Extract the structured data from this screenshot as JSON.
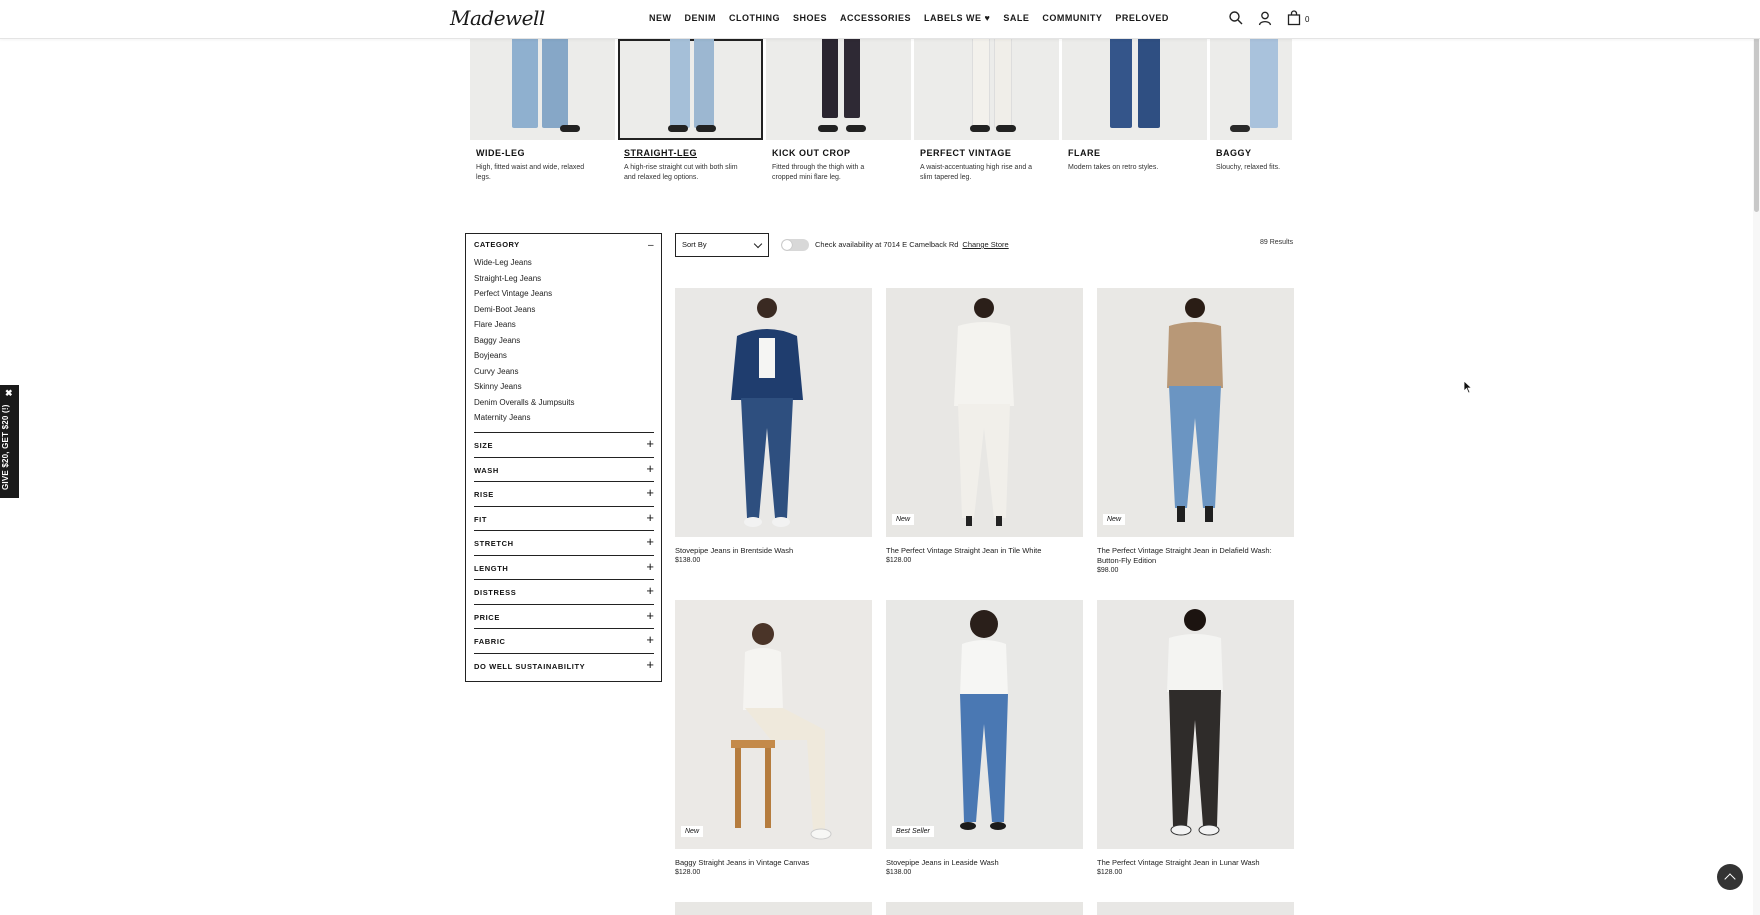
{
  "header": {
    "logo": "Madewell",
    "nav": [
      "NEW",
      "DENIM",
      "CLOTHING",
      "SHOES",
      "ACCESSORIES",
      "LABELS WE ♥",
      "SALE",
      "COMMUNITY",
      "PRELOVED"
    ],
    "bag_count": "0",
    "icons": [
      "search-icon",
      "account-icon",
      "bag-icon"
    ]
  },
  "fits": [
    {
      "title": "WIDE-LEG",
      "desc": "High, fitted waist and wide, relaxed legs.",
      "selected": false
    },
    {
      "title": "STRAIGHT-LEG",
      "desc": "A high-rise straight cut with both slim and relaxed leg options.",
      "selected": true
    },
    {
      "title": "KICK OUT CROP",
      "desc": "Fitted through the thigh with a cropped mini flare leg.",
      "selected": false
    },
    {
      "title": "PERFECT VINTAGE",
      "desc": "A waist-accentuating high rise and a slim tapered leg.",
      "selected": false
    },
    {
      "title": "FLARE",
      "desc": "Modern takes on retro styles.",
      "selected": false
    },
    {
      "title": "BAGGY",
      "desc": "Slouchy, relaxed fits.",
      "selected": false
    }
  ],
  "sidebar": {
    "category_title": "CATEGORY",
    "category_toggle": "–",
    "categories": [
      "Wide-Leg Jeans",
      "Straight-Leg Jeans",
      "Perfect Vintage Jeans",
      "Demi-Boot Jeans",
      "Flare Jeans",
      "Baggy Jeans",
      "Boyjeans",
      "Curvy Jeans",
      "Skinny Jeans",
      "Denim Overalls & Jumpsuits",
      "Maternity Jeans"
    ],
    "filters": [
      "SIZE",
      "WASH",
      "RISE",
      "FIT",
      "STRETCH",
      "LENGTH",
      "DISTRESS",
      "PRICE",
      "FABRIC",
      "DO WELL SUSTAINABILITY"
    ],
    "expand_symbol": "+"
  },
  "toolbar": {
    "sort_label": "Sort By",
    "availability_text": "Check availability at 7014 E Camelback Rd",
    "change_store": "Change Store",
    "results": "89 Results"
  },
  "products": [
    {
      "name": "Stovepipe Jeans in Brentside Wash",
      "price": "$138.00",
      "badge": ""
    },
    {
      "name": "The Perfect Vintage Straight Jean in Tile White",
      "price": "$128.00",
      "badge": "New"
    },
    {
      "name": "The Perfect Vintage Straight Jean in Delafield Wash: Button-Fly Edition",
      "price": "$98.00",
      "badge": "New"
    },
    {
      "name": "Baggy Straight Jeans in Vintage Canvas",
      "price": "$128.00",
      "badge": "New"
    },
    {
      "name": "Stovepipe Jeans in Leaside Wash",
      "price": "$138.00",
      "badge": "Best Seller"
    },
    {
      "name": "The Perfect Vintage Straight Jean in Lunar Wash",
      "price": "$128.00",
      "badge": ""
    }
  ],
  "promo": {
    "close": "✖",
    "text": "GIVE $20, GET $20 (!)"
  },
  "colors": {
    "text": "#111111",
    "background": "#ffffff",
    "promo": "#1a1a1a"
  }
}
